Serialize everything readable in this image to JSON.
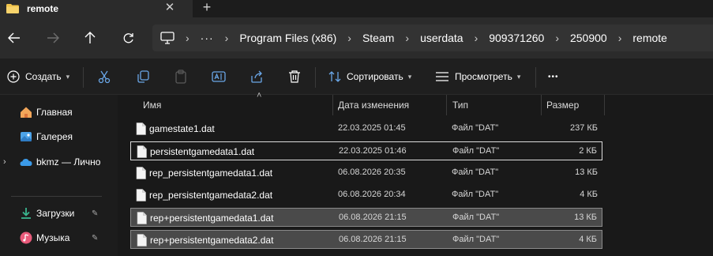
{
  "window": {
    "tab_title": "remote",
    "close_glyph": "✕",
    "new_tab_glyph": "+"
  },
  "address_bar": {
    "overflow": "···",
    "breadcrumbs": [
      "Program Files (x86)",
      "Steam",
      "userdata",
      "909371260",
      "250900",
      "remote"
    ],
    "separator": "›"
  },
  "toolbar": {
    "create_label": "Создать",
    "sort_label": "Сортировать",
    "view_label": "Просмотреть",
    "more_glyph": "•••",
    "icons": [
      "new-icon",
      "cut-icon",
      "copy-icon",
      "paste-icon",
      "rename-icon",
      "share-icon",
      "delete-icon",
      "sort-icon",
      "view-icon",
      "more-icon"
    ]
  },
  "sidebar": {
    "items": [
      {
        "label": "Главная",
        "icon": "home-icon"
      },
      {
        "label": "Галерея",
        "icon": "gallery-icon"
      },
      {
        "label": "bkmz — Лично",
        "icon": "onedrive-icon"
      },
      {
        "label": "Загрузки",
        "icon": "downloads-icon"
      },
      {
        "label": "Музыка",
        "icon": "music-icon"
      }
    ]
  },
  "file_list": {
    "columns": {
      "name": "Имя",
      "modified": "Дата изменения",
      "type": "Тип",
      "size": "Размер"
    },
    "rows": [
      {
        "name": "gamestate1.dat",
        "modified": "22.03.2025 01:45",
        "type": "Файл \"DAT\"",
        "size": "237 КБ",
        "state": "normal"
      },
      {
        "name": "persistentgamedata1.dat",
        "modified": "22.03.2025 01:46",
        "type": "Файл \"DAT\"",
        "size": "2 КБ",
        "state": "focused"
      },
      {
        "name": "rep_persistentgamedata1.dat",
        "modified": "06.08.2026 20:35",
        "type": "Файл \"DAT\"",
        "size": "13 КБ",
        "state": "normal"
      },
      {
        "name": "rep_persistentgamedata2.dat",
        "modified": "06.08.2026 20:34",
        "type": "Файл \"DAT\"",
        "size": "4 КБ",
        "state": "normal"
      },
      {
        "name": "rep+persistentgamedata1.dat",
        "modified": "06.08.2026 21:15",
        "type": "Файл \"DAT\"",
        "size": "13 КБ",
        "state": "selected"
      },
      {
        "name": "rep+persistentgamedata2.dat",
        "modified": "06.08.2026 21:15",
        "type": "Файл \"DAT\"",
        "size": "4 КБ",
        "state": "selected"
      }
    ]
  },
  "colors": {
    "background": "#1c1c1c",
    "navbar": "#2b2b2b",
    "selection": "#4a4a4a",
    "folder": "#f0c34a"
  }
}
